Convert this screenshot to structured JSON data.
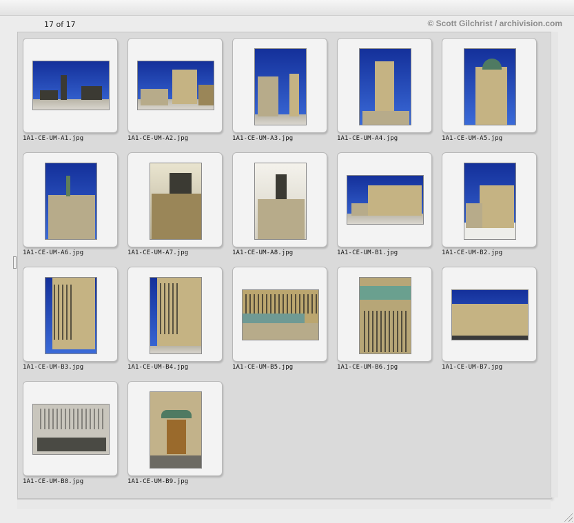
{
  "header": {
    "count": "17 of 17",
    "copyright": "© Scott Gilchrist / archivision.com"
  },
  "colors": {
    "panel": "#dadada",
    "slide": "#f3f3f3",
    "sky": "#2a4fc0"
  },
  "thumbnails": [
    {
      "filename": "1A1-CE-UM-A1.jpg",
      "subject": "campus skyline with tower"
    },
    {
      "filename": "1A1-CE-UM-A2.jpg",
      "subject": "stepped facade building"
    },
    {
      "filename": "1A1-CE-UM-A3.jpg",
      "subject": "tower and wing in winter"
    },
    {
      "filename": "1A1-CE-UM-A4.jpg",
      "subject": "central tower"
    },
    {
      "filename": "1A1-CE-UM-A5.jpg",
      "subject": "domed tower top"
    },
    {
      "filename": "1A1-CE-UM-A6.jpg",
      "subject": "stepped pavilion with spire"
    },
    {
      "filename": "1A1-CE-UM-A7.jpg",
      "subject": "dark tower cap"
    },
    {
      "filename": "1A1-CE-UM-A8.jpg",
      "subject": "stepped entrance pavilion"
    },
    {
      "filename": "1A1-CE-UM-B1.jpg",
      "subject": "long facade with plaza"
    },
    {
      "filename": "1A1-CE-UM-B2.jpg",
      "subject": "corner wing in snow"
    },
    {
      "filename": "1A1-CE-UM-B3.jpg",
      "subject": "windowed corner tower"
    },
    {
      "filename": "1A1-CE-UM-B4.jpg",
      "subject": "corner tower close view"
    },
    {
      "filename": "1A1-CE-UM-B5.jpg",
      "subject": "green roof and wing"
    },
    {
      "filename": "1A1-CE-UM-B6.jpg",
      "subject": "green canopy facade"
    },
    {
      "filename": "1A1-CE-UM-B7.jpg",
      "subject": "wide courtyard facade"
    },
    {
      "filename": "1A1-CE-UM-B8.jpg",
      "subject": "symmetric facade with trees"
    },
    {
      "filename": "1A1-CE-UM-B9.jpg",
      "subject": "entrance doorway"
    }
  ]
}
